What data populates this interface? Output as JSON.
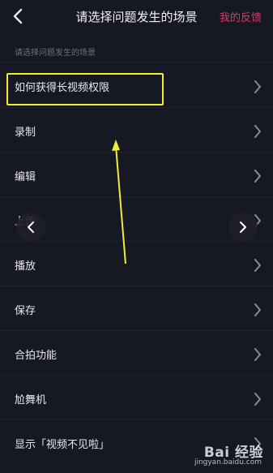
{
  "header": {
    "title": "请选择问题发生的场景",
    "feedback_label": "我的反馈",
    "back_icon": "chevron-left-icon"
  },
  "subtitle": "请选择问题发生的场景",
  "list": {
    "items": [
      {
        "label": "如何获得长视频权限"
      },
      {
        "label": "录制"
      },
      {
        "label": "编辑"
      },
      {
        "label": "上传"
      },
      {
        "label": "播放"
      },
      {
        "label": "保存"
      },
      {
        "label": "合拍功能"
      },
      {
        "label": "尬舞机"
      },
      {
        "label": "显示「视频不见啦」"
      }
    ],
    "chevron_icon": "chevron-right-icon"
  },
  "annotation": {
    "highlight_color": "#f3ee2c",
    "arrow_color": "#f3ee2c"
  },
  "watermark": {
    "top": "Bai 经验",
    "bottom": "jingyan.baidu.com"
  },
  "colors": {
    "background": "#161823",
    "accent": "#f0315c",
    "text": "#e9e9ec",
    "muted": "#6e6f78"
  }
}
